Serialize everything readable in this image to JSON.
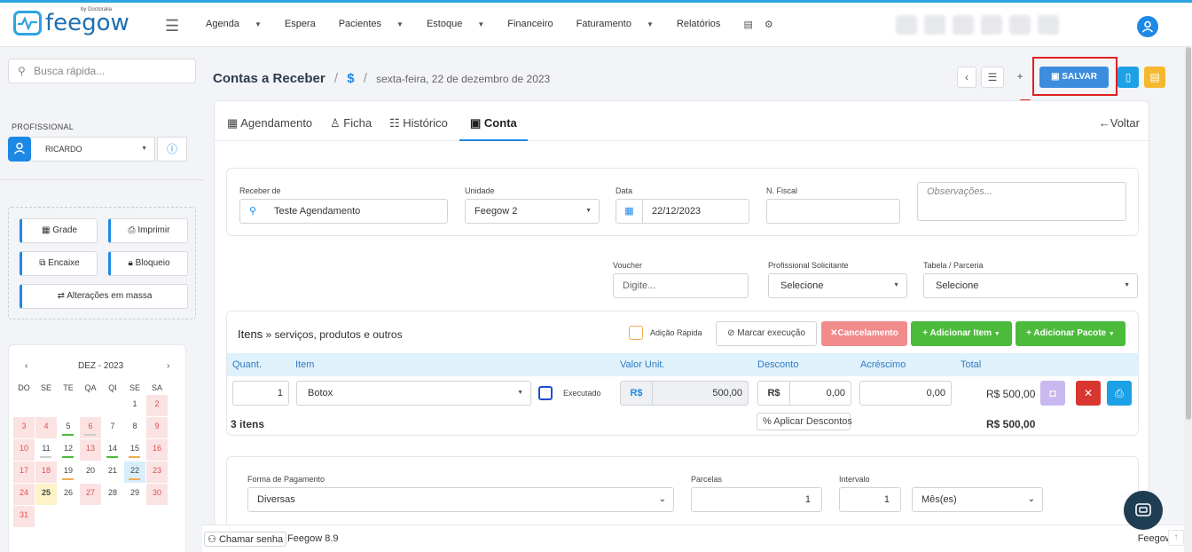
{
  "brand": {
    "name": "feegow",
    "tagline": "by Doctoralia"
  },
  "nav": {
    "items": [
      {
        "label": "Agenda",
        "caret": true
      },
      {
        "label": "Espera",
        "caret": false
      },
      {
        "label": "Pacientes",
        "caret": true
      },
      {
        "label": "Estoque",
        "caret": true
      },
      {
        "label": "Financeiro",
        "caret": false
      },
      {
        "label": "Faturamento",
        "caret": true
      },
      {
        "label": "Relatórios",
        "caret": false
      }
    ],
    "caret_glyph": "▼"
  },
  "sidebar": {
    "search_placeholder": "Busca rápida...",
    "professional_label": "PROFISSIONAL",
    "professional_value": "RICARDO",
    "tools": {
      "grade": "Grade",
      "imprimir": "Imprimir",
      "encaixe": "Encaixe",
      "bloqueio": "Bloqueio",
      "alteracoes": "Alterações em massa"
    },
    "calendar": {
      "month": "DEZ - 2023",
      "weekdays": [
        "DO",
        "SE",
        "TE",
        "QA",
        "QI",
        "SE",
        "SA"
      ],
      "weeks": [
        [
          "",
          "",
          "",
          "",
          "",
          "1",
          "2"
        ],
        [
          "3",
          "4",
          "5",
          "6",
          "7",
          "8",
          "9"
        ],
        [
          "10",
          "11",
          "12",
          "13",
          "14",
          "15",
          "16"
        ],
        [
          "17",
          "18",
          "19",
          "20",
          "21",
          "22",
          "23"
        ],
        [
          "24",
          "25",
          "26",
          "27",
          "28",
          "29",
          "30"
        ],
        [
          "31",
          "",
          "",
          "",
          "",
          "",
          ""
        ]
      ]
    }
  },
  "header": {
    "title": "Contas a Receber",
    "separator": "/",
    "currency_symbol": "$",
    "date": "sexta-feira, 22 de dezembro de 2023",
    "save_label": "SALVAR"
  },
  "tabs": {
    "agendamento": "Agendamento",
    "ficha": "Ficha",
    "historico": "Histórico",
    "conta": "Conta",
    "voltar": "Voltar"
  },
  "form": {
    "receber_de_label": "Receber de",
    "receber_de_value": "Teste Agendamento",
    "unidade_label": "Unidade",
    "unidade_value": "Feegow 2",
    "data_label": "Data",
    "data_value": "22/12/2023",
    "nfiscal_label": "N. Fiscal",
    "observacoes_placeholder": "Observações...",
    "voucher_label": "Voucher",
    "voucher_placeholder": "Digite...",
    "prof_solicitante_label": "Profissional Solicitante",
    "prof_solicitante_value": "Selecione",
    "tabela_label": "Tabela / Parceria",
    "tabela_value": "Selecione"
  },
  "items": {
    "title_bold": "Itens",
    "title_rest": " » serviços, produtos e outros",
    "adicao_rapida": "Adição Rápida",
    "marcar_execucao": "Marcar execução",
    "cancelamento": "Cancelamento",
    "adicionar_item": "+ Adicionar Item",
    "adicionar_pacote": "+ Adicionar Pacote",
    "columns": {
      "quant": "Quant.",
      "item": "Item",
      "valor_unit": "Valor Unit.",
      "desconto": "Desconto",
      "acrescimo": "Acréscimo",
      "total": "Total"
    },
    "row": {
      "quant": "1",
      "item": "Botox",
      "executado": "Executado",
      "currency": "R$",
      "valor_unit": "500,00",
      "desconto": "0,00",
      "acrescimo": "0,00",
      "total": "R$ 500,00"
    },
    "count": "3 itens",
    "aplicar_descontos": "Aplicar Descontos",
    "grand_total": "R$ 500,00"
  },
  "payment": {
    "forma_label": "Forma de Pagamento",
    "forma_value": "Diversas",
    "parcelas_label": "Parcelas",
    "parcelas_value": "1",
    "intervalo_label": "Intervalo",
    "intervalo_value": "1",
    "periodo_value": "Mês(es)"
  },
  "footer": {
    "chamar_senha": "Chamar senha",
    "version": "Feegow 8.9",
    "unit": "Feegow 2"
  },
  "colors": {
    "primary": "#1e88e5",
    "save": "#3c8dde",
    "danger": "#d9362f",
    "cancel_soft": "#f28b8b",
    "success": "#4cbb3c",
    "warning": "#f0ad4e",
    "highlight": "#e02020"
  }
}
